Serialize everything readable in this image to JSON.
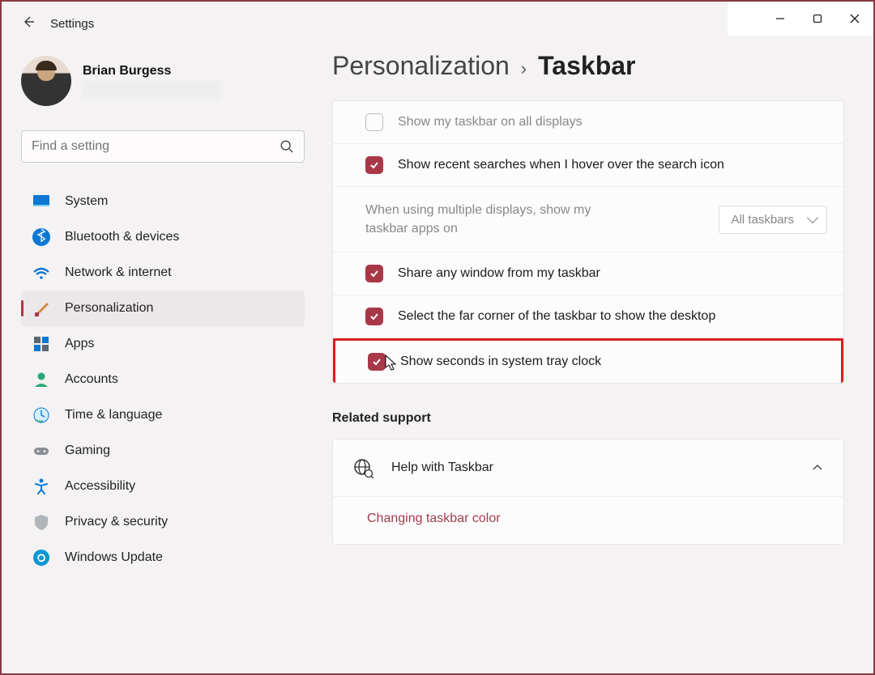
{
  "app": {
    "title": "Settings"
  },
  "profile": {
    "name": "Brian Burgess"
  },
  "search": {
    "placeholder": "Find a setting"
  },
  "sidebar": {
    "items": [
      {
        "label": "System"
      },
      {
        "label": "Bluetooth & devices"
      },
      {
        "label": "Network & internet"
      },
      {
        "label": "Personalization"
      },
      {
        "label": "Apps"
      },
      {
        "label": "Accounts"
      },
      {
        "label": "Time & language"
      },
      {
        "label": "Gaming"
      },
      {
        "label": "Accessibility"
      },
      {
        "label": "Privacy & security"
      },
      {
        "label": "Windows Update"
      }
    ]
  },
  "breadcrumb": {
    "parent": "Personalization",
    "current": "Taskbar"
  },
  "settings": [
    {
      "label": "Show my taskbar on all displays"
    },
    {
      "label": "Show recent searches when I hover over the search icon"
    },
    {
      "label": "When using multiple displays, show my taskbar apps on",
      "select": "All taskbars"
    },
    {
      "label": "Share any window from my taskbar"
    },
    {
      "label": "Select the far corner of the taskbar to show the desktop"
    },
    {
      "label": "Show seconds in system tray clock"
    }
  ],
  "related": {
    "title": "Related support",
    "help": "Help with Taskbar",
    "link": "Changing taskbar color"
  }
}
